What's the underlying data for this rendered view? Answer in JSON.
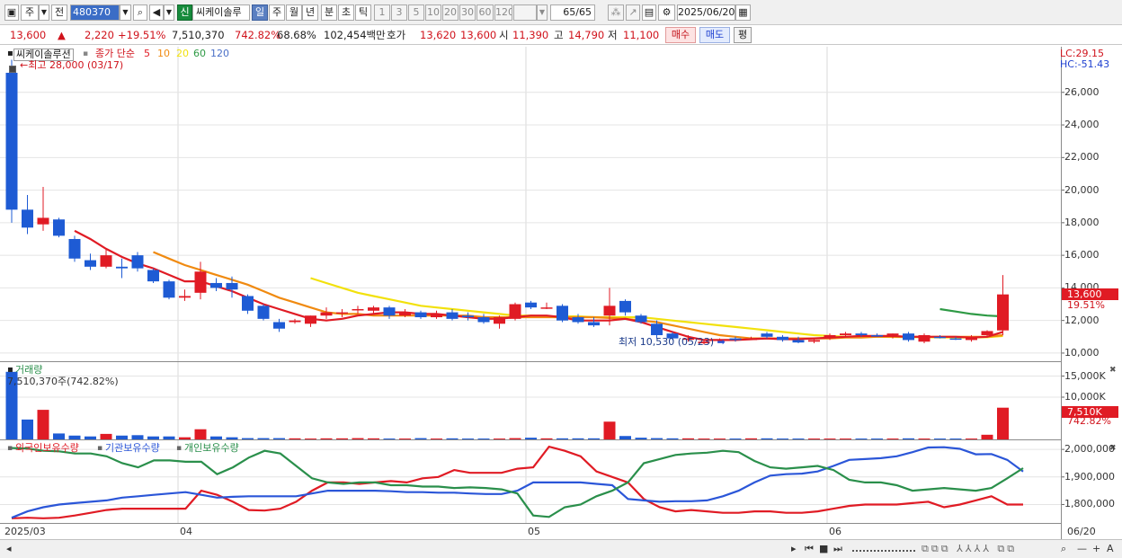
{
  "toolbar": {
    "market": "주",
    "prev_label": "전",
    "code": "480370",
    "new_badge": "신",
    "stock_name": "씨케이솔루",
    "periods": [
      "일",
      "주",
      "월",
      "년",
      "분",
      "초",
      "틱"
    ],
    "active_period": "일",
    "intervals": [
      "1",
      "3",
      "5",
      "10",
      "20",
      "30",
      "60",
      "120"
    ],
    "count": "65/65",
    "date": "2025/06/20"
  },
  "quote": {
    "price": "13,600",
    "arrow": "▲",
    "change": "2,220",
    "change_pct": "+19.51%",
    "volume": "7,510,370",
    "volume_ratio": "742.82%",
    "turnover": "68.68%",
    "trade_value": "102,454백만",
    "hoga_label": "호가",
    "ask": "13,620",
    "bid": "13,600",
    "open_label": "시",
    "open": "11,390",
    "high_label": "고",
    "high": "14,790",
    "low_label": "저",
    "low": "11,100",
    "buy_button": "매수",
    "sell_button": "매도",
    "eval_button": "평"
  },
  "price_pane": {
    "title": "씨케이솔루션",
    "ma_title": "종가 단순",
    "ma_periods": [
      "5",
      "10",
      "20",
      "60",
      "120"
    ],
    "ma_colors": [
      "#e01b24",
      "#f08a10",
      "#f2e10c",
      "#2e9a45",
      "#4a6fc7"
    ],
    "lc": "LC:29.15",
    "hc": "HC:-51.43",
    "high_annotation": "최고 28,000 (03/17)",
    "low_annotation": "최저 10,530 (05/23)",
    "price_badge": "13,600",
    "pct_label": "19.51%"
  },
  "volume_pane": {
    "title": "거래량",
    "value_label": "7,510,370주(742.82%)",
    "badge": "7,510K",
    "pct_label": "742.82%"
  },
  "holdings_pane": {
    "series_names": [
      "외국인보유수량",
      "기관보유수량",
      "개인보유수량"
    ],
    "series_colors": [
      "#e01b24",
      "#2b56d8",
      "#2a8f4b"
    ]
  },
  "x_axis": {
    "labels": [
      "2025/03",
      "04",
      "05",
      "06",
      "06/20"
    ]
  },
  "chart_data": [
    {
      "type": "candlestick",
      "title": "씨케이솔루션",
      "y_ticks": [
        10000,
        12000,
        14000,
        16000,
        18000,
        20000,
        22000,
        24000,
        26000
      ],
      "y_tick_labels": [
        "10,000",
        "12,000",
        "14,000",
        "16,000",
        "18,000",
        "20,000",
        "22,000",
        "24,000",
        "26,000"
      ],
      "ylim": [
        9500,
        28800
      ],
      "candles": [
        {
          "o": 27200,
          "h": 28000,
          "l": 18000,
          "c": 18800
        },
        {
          "o": 18800,
          "h": 19700,
          "l": 17300,
          "c": 17700
        },
        {
          "o": 17900,
          "h": 20200,
          "l": 17500,
          "c": 18300
        },
        {
          "o": 18200,
          "h": 18300,
          "l": 17100,
          "c": 17200
        },
        {
          "o": 17000,
          "h": 17200,
          "l": 15600,
          "c": 15800
        },
        {
          "o": 15700,
          "h": 16100,
          "l": 15100,
          "c": 15300
        },
        {
          "o": 15300,
          "h": 16400,
          "l": 15200,
          "c": 16000
        },
        {
          "o": 15300,
          "h": 15800,
          "l": 14600,
          "c": 15200
        },
        {
          "o": 16000,
          "h": 16200,
          "l": 15000,
          "c": 15200
        },
        {
          "o": 15100,
          "h": 15200,
          "l": 14300,
          "c": 14400
        },
        {
          "o": 14400,
          "h": 14500,
          "l": 13300,
          "c": 13400
        },
        {
          "o": 13400,
          "h": 13900,
          "l": 13200,
          "c": 13500
        },
        {
          "o": 13700,
          "h": 15600,
          "l": 13300,
          "c": 15000
        },
        {
          "o": 14300,
          "h": 14600,
          "l": 13800,
          "c": 14000
        },
        {
          "o": 14300,
          "h": 14700,
          "l": 13400,
          "c": 13900
        },
        {
          "o": 13500,
          "h": 13600,
          "l": 12400,
          "c": 12600
        },
        {
          "o": 12900,
          "h": 13000,
          "l": 12000,
          "c": 12100
        },
        {
          "o": 11900,
          "h": 12100,
          "l": 11300,
          "c": 11500
        },
        {
          "o": 11900,
          "h": 12100,
          "l": 11800,
          "c": 12000
        },
        {
          "o": 11800,
          "h": 12300,
          "l": 11600,
          "c": 12300
        },
        {
          "o": 12300,
          "h": 12800,
          "l": 12100,
          "c": 12500
        },
        {
          "o": 12500,
          "h": 12700,
          "l": 12200,
          "c": 12500
        },
        {
          "o": 12700,
          "h": 12900,
          "l": 12400,
          "c": 12700
        },
        {
          "o": 12600,
          "h": 12900,
          "l": 12400,
          "c": 12800
        },
        {
          "o": 12800,
          "h": 12900,
          "l": 12100,
          "c": 12300
        },
        {
          "o": 12300,
          "h": 12700,
          "l": 12200,
          "c": 12500
        },
        {
          "o": 12500,
          "h": 12600,
          "l": 12100,
          "c": 12200
        },
        {
          "o": 12200,
          "h": 12600,
          "l": 12100,
          "c": 12400
        },
        {
          "o": 12500,
          "h": 12700,
          "l": 12000,
          "c": 12100
        },
        {
          "o": 12300,
          "h": 12500,
          "l": 12000,
          "c": 12200
        },
        {
          "o": 12200,
          "h": 12400,
          "l": 11800,
          "c": 11900
        },
        {
          "o": 11800,
          "h": 12300,
          "l": 11500,
          "c": 12200
        },
        {
          "o": 12100,
          "h": 13100,
          "l": 12000,
          "c": 13000
        },
        {
          "o": 13100,
          "h": 13200,
          "l": 12700,
          "c": 12800
        },
        {
          "o": 12800,
          "h": 13100,
          "l": 12700,
          "c": 12800
        },
        {
          "o": 12900,
          "h": 13000,
          "l": 11900,
          "c": 12000
        },
        {
          "o": 12200,
          "h": 12400,
          "l": 11800,
          "c": 11900
        },
        {
          "o": 11900,
          "h": 12200,
          "l": 11600,
          "c": 11700
        },
        {
          "o": 12300,
          "h": 14000,
          "l": 11700,
          "c": 12900
        },
        {
          "o": 13200,
          "h": 13300,
          "l": 12300,
          "c": 12500
        },
        {
          "o": 12300,
          "h": 12400,
          "l": 11800,
          "c": 11900
        },
        {
          "o": 11800,
          "h": 12000,
          "l": 10900,
          "c": 11100
        },
        {
          "o": 11200,
          "h": 11300,
          "l": 10800,
          "c": 10900
        },
        {
          "o": 10900,
          "h": 11100,
          "l": 10700,
          "c": 10900
        },
        {
          "o": 10600,
          "h": 10800,
          "l": 10530,
          "c": 10700
        },
        {
          "o": 10800,
          "h": 10900,
          "l": 10700,
          "c": 10850
        },
        {
          "o": 10900,
          "h": 11000,
          "l": 10700,
          "c": 10800
        },
        {
          "o": 10800,
          "h": 11000,
          "l": 10800,
          "c": 10900
        },
        {
          "o": 11200,
          "h": 11300,
          "l": 10900,
          "c": 11000
        },
        {
          "o": 11000,
          "h": 11100,
          "l": 10700,
          "c": 10800
        },
        {
          "o": 10800,
          "h": 11000,
          "l": 10600,
          "c": 10650
        },
        {
          "o": 10700,
          "h": 10900,
          "l": 10600,
          "c": 10800
        },
        {
          "o": 10900,
          "h": 11200,
          "l": 10800,
          "c": 11100
        },
        {
          "o": 11100,
          "h": 11300,
          "l": 11000,
          "c": 11200
        },
        {
          "o": 11200,
          "h": 11300,
          "l": 11000,
          "c": 11100
        },
        {
          "o": 11100,
          "h": 11200,
          "l": 11000,
          "c": 11050
        },
        {
          "o": 11100,
          "h": 11200,
          "l": 10900,
          "c": 11200
        },
        {
          "o": 11200,
          "h": 11300,
          "l": 10700,
          "c": 10800
        },
        {
          "o": 10700,
          "h": 11200,
          "l": 10600,
          "c": 11100
        },
        {
          "o": 11000,
          "h": 11100,
          "l": 10900,
          "c": 10950
        },
        {
          "o": 10900,
          "h": 11000,
          "l": 10800,
          "c": 10850
        },
        {
          "o": 10800,
          "h": 11100,
          "l": 10700,
          "c": 11000
        },
        {
          "o": 11100,
          "h": 11400,
          "l": 11000,
          "c": 11350
        },
        {
          "o": 11390,
          "h": 14790,
          "l": 11100,
          "c": 13600
        }
      ],
      "ma5": [
        null,
        null,
        null,
        null,
        17500,
        17000,
        16400,
        15900,
        15500,
        15200,
        14800,
        14400,
        14400,
        14100,
        13800,
        13400,
        13000,
        12700,
        12400,
        12100,
        12000,
        12100,
        12300,
        12400,
        12500,
        12500,
        12400,
        12400,
        12300,
        12200,
        12100,
        12100,
        12200,
        12300,
        12300,
        12200,
        12000,
        12000,
        12000,
        12100,
        11900,
        11600,
        11300,
        11000,
        10800,
        10800,
        10800,
        10850,
        10900,
        10850,
        10850,
        10900,
        10950,
        11000,
        11050,
        11050,
        11050,
        11000,
        11000,
        11000,
        11000,
        10950,
        11000,
        11300
      ],
      "ma10": [
        null,
        null,
        null,
        null,
        null,
        null,
        null,
        null,
        null,
        16200,
        15800,
        15400,
        15100,
        14800,
        14500,
        14200,
        13800,
        13400,
        13100,
        12800,
        12500,
        12400,
        12400,
        12300,
        12300,
        12300,
        12300,
        12300,
        12300,
        12300,
        12200,
        12200,
        12200,
        12200,
        12200,
        12200,
        12200,
        12200,
        12150,
        12100,
        12000,
        11900,
        11700,
        11500,
        11300,
        11100,
        11000,
        10900,
        10900,
        10900,
        10900,
        10900,
        10900,
        10950,
        10950,
        11000,
        11000,
        11000,
        11000,
        11000,
        11000,
        11000,
        11000,
        11100
      ],
      "ma20": [
        null,
        null,
        null,
        null,
        null,
        null,
        null,
        null,
        null,
        null,
        null,
        null,
        null,
        null,
        null,
        null,
        null,
        null,
        null,
        14600,
        14300,
        14000,
        13700,
        13500,
        13300,
        13100,
        12900,
        12800,
        12700,
        12600,
        12500,
        12400,
        12300,
        12300,
        12250,
        12250,
        12250,
        12200,
        12200,
        12200,
        12200,
        12100,
        12000,
        11900,
        11800,
        11700,
        11600,
        11500,
        11400,
        11300,
        11200,
        11100,
        11050,
        11000,
        11000,
        11000,
        10990,
        10980,
        10970,
        10960,
        10960,
        10950,
        10970,
        11050
      ],
      "ma60": [
        null,
        null,
        null,
        null,
        null,
        null,
        null,
        null,
        null,
        null,
        null,
        null,
        null,
        null,
        null,
        null,
        null,
        null,
        null,
        null,
        null,
        null,
        null,
        null,
        null,
        null,
        null,
        null,
        null,
        null,
        null,
        null,
        null,
        null,
        null,
        null,
        null,
        null,
        null,
        null,
        null,
        null,
        null,
        null,
        null,
        null,
        null,
        null,
        null,
        null,
        null,
        null,
        null,
        null,
        null,
        null,
        null,
        null,
        null,
        12700,
        12550,
        12400,
        12300,
        12250
      ]
    },
    {
      "type": "bar",
      "title": "거래량",
      "y_tick_labels": [
        "10,000K",
        "15,000K"
      ],
      "y_ticks": [
        10000,
        15000
      ],
      "ylim": [
        0,
        18300
      ],
      "unit": "K",
      "values": [
        16000,
        4700,
        7000,
        1400,
        900,
        700,
        1300,
        900,
        1000,
        700,
        700,
        500,
        2400,
        700,
        500,
        300,
        300,
        300,
        250,
        200,
        250,
        250,
        300,
        250,
        200,
        200,
        300,
        200,
        250,
        200,
        200,
        200,
        300,
        400,
        250,
        250,
        250,
        250,
        4200,
        800,
        400,
        300,
        250,
        250,
        200,
        200,
        200,
        250,
        250,
        200,
        200,
        200,
        200,
        200,
        200,
        200,
        200,
        250,
        200,
        200,
        200,
        200,
        1100,
        7510
      ]
    },
    {
      "type": "line",
      "series_labels": [
        "외국인보유수량",
        "기관보유수량",
        "개인보유수량"
      ],
      "y_ticks": [
        1800000,
        1900000,
        2000000
      ],
      "y_tick_labels": [
        "1,800,000",
        "1,900,000",
        "2,000,000"
      ],
      "ylim": [
        1733000,
        2033000
      ],
      "series": [
        {
          "values": [
            1750000,
            1752000,
            1750000,
            1752000,
            1760000,
            1770000,
            1780000,
            1785000,
            1785000,
            1785000,
            1785000,
            1785000,
            1850000,
            1835000,
            1810000,
            1780000,
            1778000,
            1785000,
            1810000,
            1850000,
            1880000,
            1880000,
            1875000,
            1880000,
            1885000,
            1880000,
            1895000,
            1900000,
            1925000,
            1915000,
            1915000,
            1915000,
            1930000,
            1935000,
            2010000,
            1995000,
            1975000,
            1920000,
            1900000,
            1880000,
            1820000,
            1790000,
            1775000,
            1780000,
            1775000,
            1770000,
            1770000,
            1775000,
            1775000,
            1770000,
            1770000,
            1775000,
            1785000,
            1795000,
            1800000,
            1800000,
            1800000,
            1805000,
            1810000,
            1790000,
            1800000,
            1815000,
            1830000,
            1800000,
            1800000
          ]
        },
        {
          "values": [
            1752000,
            1775000,
            1790000,
            1800000,
            1805000,
            1810000,
            1815000,
            1825000,
            1830000,
            1835000,
            1840000,
            1845000,
            1835000,
            1825000,
            1828000,
            1830000,
            1830000,
            1830000,
            1830000,
            1840000,
            1850000,
            1850000,
            1850000,
            1850000,
            1848000,
            1845000,
            1845000,
            1843000,
            1843000,
            1840000,
            1838000,
            1838000,
            1850000,
            1880000,
            1880000,
            1880000,
            1880000,
            1875000,
            1870000,
            1820000,
            1815000,
            1810000,
            1812000,
            1812000,
            1815000,
            1830000,
            1850000,
            1880000,
            1905000,
            1910000,
            1912000,
            1920000,
            1940000,
            1962000,
            1965000,
            1968000,
            1975000,
            1990000,
            2007000,
            2008000,
            2002000,
            1982000,
            1983000,
            1962000,
            1920000
          ]
        },
        {
          "values": [
            2005000,
            2003000,
            1995000,
            1993000,
            1985000,
            1985000,
            1975000,
            1950000,
            1935000,
            1960000,
            1960000,
            1955000,
            1955000,
            1910000,
            1935000,
            1970000,
            1995000,
            1985000,
            1940000,
            1895000,
            1880000,
            1875000,
            1880000,
            1880000,
            1870000,
            1870000,
            1865000,
            1865000,
            1860000,
            1862000,
            1860000,
            1855000,
            1840000,
            1760000,
            1755000,
            1790000,
            1800000,
            1830000,
            1850000,
            1880000,
            1950000,
            1965000,
            1980000,
            1985000,
            1988000,
            1995000,
            1990000,
            1958000,
            1935000,
            1930000,
            1935000,
            1940000,
            1925000,
            1890000,
            1880000,
            1880000,
            1870000,
            1850000,
            1855000,
            1860000,
            1855000,
            1850000,
            1860000,
            1895000,
            1932000
          ]
        }
      ]
    }
  ]
}
